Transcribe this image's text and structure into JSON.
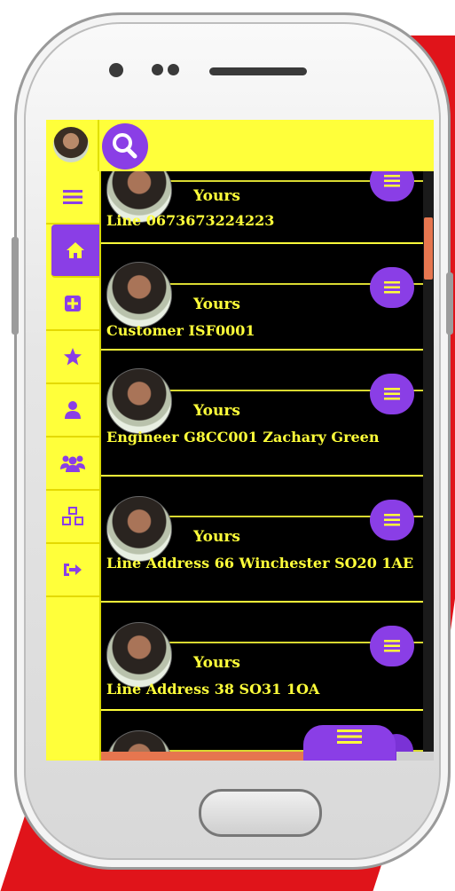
{
  "colors": {
    "accent_yellow": "#ffff3a",
    "accent_purple": "#8a3ee6",
    "list_background": "#000000",
    "scroll_orange": "#e6764f",
    "backdrop_red": "#e0141a"
  },
  "topbar": {
    "avatar_icon": "user-avatar",
    "search_icon": "search-icon"
  },
  "sidebar": {
    "items": [
      {
        "icon": "hamburger-menu-icon",
        "glyph": "≡"
      },
      {
        "icon": "home-icon",
        "glyph": "⌂",
        "active": true
      },
      {
        "icon": "plus-square-icon",
        "glyph": "+"
      },
      {
        "icon": "star-icon",
        "glyph": "★"
      },
      {
        "icon": "user-icon",
        "glyph": "●"
      },
      {
        "icon": "users-group-icon",
        "glyph": "●●"
      },
      {
        "icon": "cubes-icon",
        "glyph": "◆"
      },
      {
        "icon": "sign-out-icon",
        "glyph": "➔"
      }
    ]
  },
  "list": {
    "items": [
      {
        "owner": "Yours",
        "text": "Line 0673673224223"
      },
      {
        "owner": "Yours",
        "text": "Customer ISF0001"
      },
      {
        "owner": "Yours",
        "text": "Engineer G8CC001 Zachary Green"
      },
      {
        "owner": "Yours",
        "text": "Line Address 66 Winchester SO20 1AE"
      },
      {
        "owner": "Yours",
        "text": "Line Address 38 SO31 1OA"
      }
    ]
  },
  "fab": {
    "icon": "hamburger-menu-icon"
  }
}
